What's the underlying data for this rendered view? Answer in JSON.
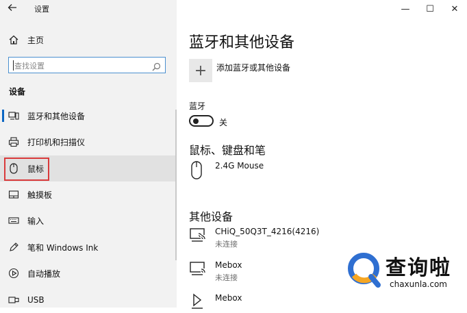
{
  "window": {
    "title": "设置",
    "controls": {
      "minimize": "—",
      "maximize": "☐",
      "close": "✕"
    }
  },
  "sidebar": {
    "home_label": "主页",
    "search_placeholder": "查找设置",
    "section_label": "设备",
    "items": [
      {
        "label": "蓝牙和其他设备",
        "icon": "bluetooth-devices-icon"
      },
      {
        "label": "打印机和扫描仪",
        "icon": "printer-icon"
      },
      {
        "label": "鼠标",
        "icon": "mouse-icon"
      },
      {
        "label": "触摸板",
        "icon": "touchpad-icon"
      },
      {
        "label": "输入",
        "icon": "keyboard-icon"
      },
      {
        "label": "笔和 Windows Ink",
        "icon": "pen-icon"
      },
      {
        "label": "自动播放",
        "icon": "autoplay-icon"
      },
      {
        "label": "USB",
        "icon": "usb-icon"
      }
    ]
  },
  "main": {
    "page_title": "蓝牙和其他设备",
    "add_device_label": "添加蓝牙或其他设备",
    "bluetooth_label": "蓝牙",
    "bluetooth_state": "关",
    "mouse_section": {
      "heading": "鼠标、键盘和笔",
      "devices": [
        {
          "name": "2.4G Mouse",
          "icon": "mouse-device-icon"
        }
      ]
    },
    "other_section": {
      "heading": "其他设备",
      "devices": [
        {
          "name": "CHiQ_50Q3T_4216(4216)",
          "status": "未连接",
          "icon": "display-device-icon"
        },
        {
          "name": "Mebox",
          "status": "未连接",
          "icon": "display-device-icon"
        },
        {
          "name": "Mebox",
          "status": "",
          "icon": "media-device-icon"
        }
      ]
    }
  },
  "watermark": {
    "title": "查询啦",
    "url": "chaxunla.com"
  },
  "colors": {
    "accent": "#0b66c3",
    "highlight": "#d9393a",
    "watermark_blue": "#2f6fd1",
    "watermark_orange": "#f5a623"
  }
}
